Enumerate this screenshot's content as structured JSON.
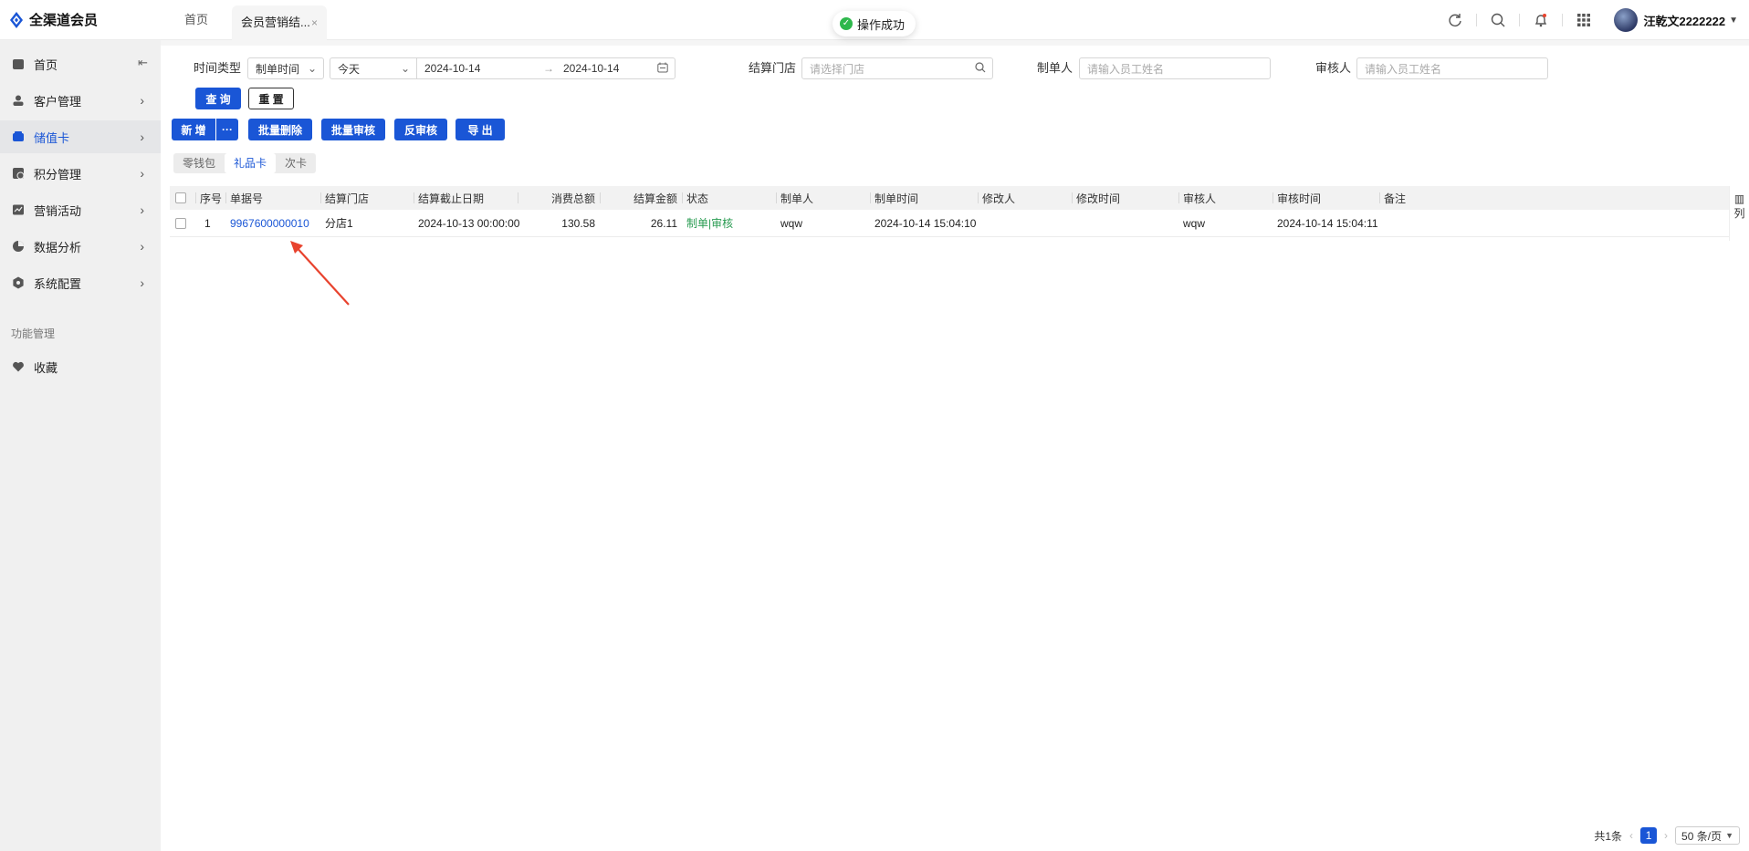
{
  "app": {
    "title": "全渠道会员"
  },
  "tabs": [
    {
      "label": "首页"
    },
    {
      "label": "会员营销结...",
      "close": "×"
    }
  ],
  "toast": {
    "text": "操作成功"
  },
  "header": {
    "username": "汪乾文2222222"
  },
  "sidebar": {
    "items": [
      {
        "label": "首页",
        "icon": "home-icon"
      },
      {
        "label": "客户管理",
        "icon": "users-icon"
      },
      {
        "label": "储值卡",
        "icon": "wallet-icon",
        "active": true
      },
      {
        "label": "积分管理",
        "icon": "points-icon"
      },
      {
        "label": "营销活动",
        "icon": "campaign-icon"
      },
      {
        "label": "数据分析",
        "icon": "pie-chart-icon"
      },
      {
        "label": "系统配置",
        "icon": "settings-icon"
      }
    ],
    "group_label": "功能管理",
    "favorites_label": "收藏"
  },
  "filters": {
    "time_type_label": "时间类型",
    "time_type_value": "制单时间",
    "period_value": "今天",
    "date_from": "2024-10-14",
    "date_to": "2024-10-14",
    "store_label": "结算门店",
    "store_placeholder": "请选择门店",
    "maker_label": "制单人",
    "maker_placeholder": "请输入员工姓名",
    "auditor_label": "审核人",
    "auditor_placeholder": "请输入员工姓名",
    "query_label": "查 询",
    "reset_label": "重 置"
  },
  "toolbar": {
    "add_label": "新 增",
    "more_label": "···",
    "batch_delete_label": "批量删除",
    "batch_audit_label": "批量审核",
    "unaudit_label": "反审核",
    "export_label": "导 出"
  },
  "segments": [
    "零钱包",
    "礼品卡",
    "次卡"
  ],
  "active_segment": "礼品卡",
  "table": {
    "columns": [
      "序号",
      "单据号",
      "结算门店",
      "结算截止日期",
      "消费总额",
      "结算金额",
      "状态",
      "制单人",
      "制单时间",
      "修改人",
      "修改时间",
      "审核人",
      "审核时间",
      "备注"
    ],
    "rows": [
      {
        "index": "1",
        "doc_no": "9967600000010",
        "store": "分店1",
        "deadline": "2024-10-13 00:00:00",
        "total": "130.58",
        "settle_amount": "26.11",
        "status": "制单|审核",
        "maker": "wqw",
        "make_time": "2024-10-14 15:04:10",
        "modifier": "",
        "modify_time": "",
        "auditor": "wqw",
        "audit_time": "2024-10-14 15:04:11",
        "remark": ""
      }
    ],
    "column_setting_label": "列"
  },
  "pagination": {
    "total_text": "共1条",
    "current_page": "1",
    "page_size": "50 条/页"
  },
  "colors": {
    "primary": "#1a56d6",
    "status_green": "#2a9c52",
    "toast_ok": "#2eb84c",
    "annotation_red": "#e8432e"
  }
}
